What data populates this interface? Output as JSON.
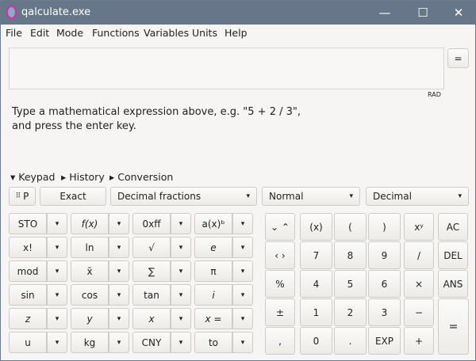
{
  "window": {
    "title": "qalculate.exe",
    "minimize": "—",
    "maximize": "☐",
    "close": "✕"
  },
  "menu": [
    "File",
    "Edit",
    "Mode",
    "Functions",
    "Variables",
    "Units",
    "Help"
  ],
  "expression": {
    "value": "",
    "equals": "=",
    "angle_mode": "RAD"
  },
  "message": {
    "line1": "Type a mathematical expression above, e.g. \"5 + 2 / 3\",",
    "line2": "and press the enter key."
  },
  "tabs": {
    "keypad": "▾ Keypad",
    "history": "▸ History",
    "conversion": "▸ Conversion"
  },
  "toolbar": {
    "programming": "P",
    "exact": "Exact",
    "fraction_mode": "Decimal fractions",
    "display_mode": "Normal",
    "base": "Decimal",
    "dropdown": "▾"
  },
  "left_keys": [
    [
      "STO",
      "f(x)",
      "0xff",
      "a(x)ᵇ"
    ],
    [
      "x!",
      "ln",
      "√",
      "e"
    ],
    [
      "mod",
      "x̄",
      "∑",
      "π"
    ],
    [
      "sin",
      "cos",
      "tan",
      "i"
    ],
    [
      "z",
      "y",
      "x",
      "x ="
    ],
    [
      "u",
      "kg",
      "CNY",
      "to"
    ]
  ],
  "right_keys": {
    "nav": [
      "⌄ ⌃",
      "‹ ›",
      "%",
      "±",
      ","
    ],
    "grid": [
      [
        "(x)",
        "(",
        ")",
        "xʸ",
        "AC"
      ],
      [
        "7",
        "8",
        "9",
        "/",
        "DEL"
      ],
      [
        "4",
        "5",
        "6",
        "×",
        "ANS"
      ],
      [
        "1",
        "2",
        "3",
        "−"
      ],
      [
        "0",
        ".",
        "EXP",
        "+"
      ]
    ],
    "equals": "="
  }
}
